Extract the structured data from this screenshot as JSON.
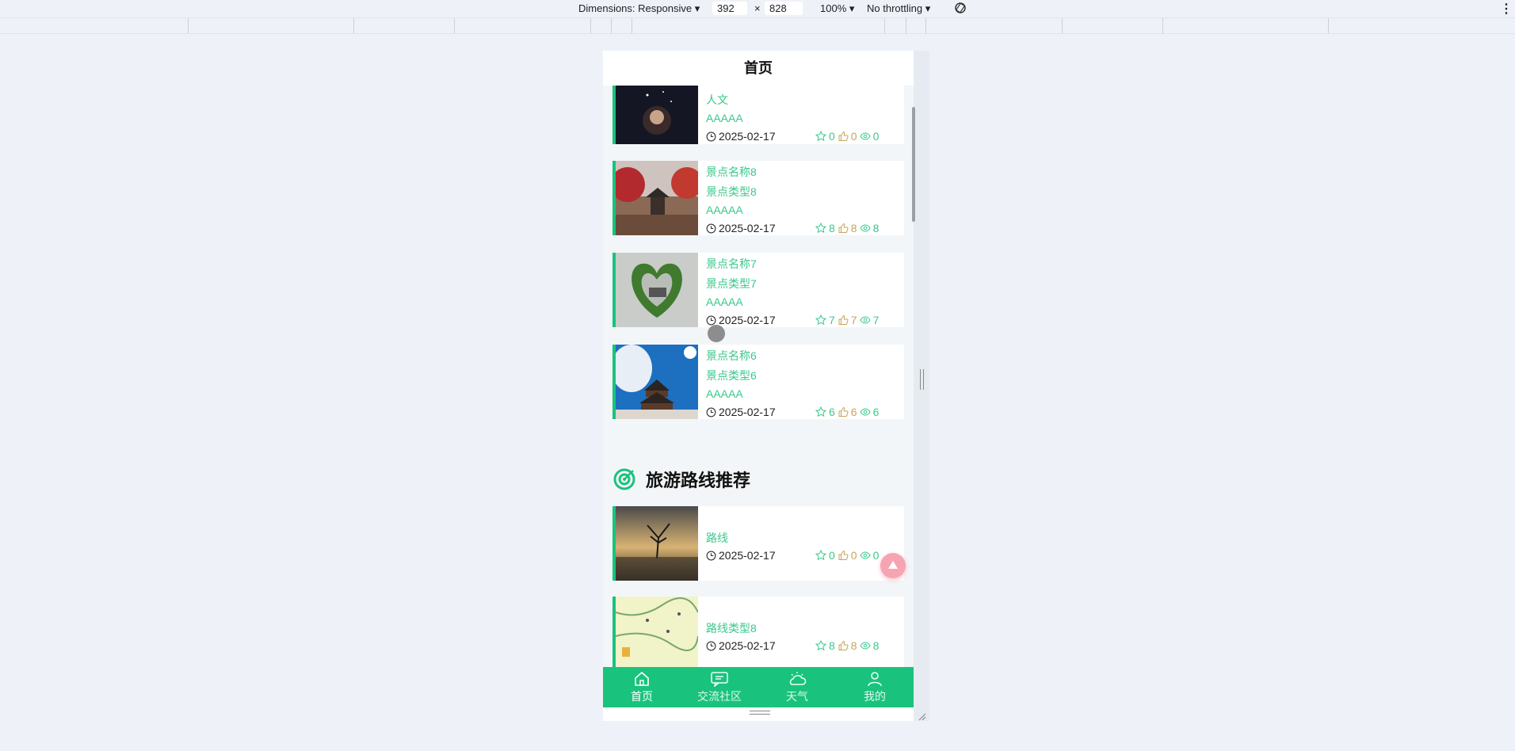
{
  "devtools": {
    "dimensions_label": "Dimensions: Responsive",
    "width": "392",
    "x": "×",
    "height": "828",
    "zoom": "100%",
    "throttling": "No throttling",
    "rotate_icon": "rotate-icon",
    "menu_icon": "more-vertical-icon"
  },
  "header": {
    "title": "首页"
  },
  "scenic_cards": [
    {
      "name": "",
      "type": "人文",
      "level": "AAAAA",
      "date": "2025-02-17",
      "stars": "0",
      "likes": "0",
      "views": "0"
    },
    {
      "name": "景点名称8",
      "type": "景点类型8",
      "level": "AAAAA",
      "date": "2025-02-17",
      "stars": "8",
      "likes": "8",
      "views": "8"
    },
    {
      "name": "景点名称7",
      "type": "景点类型7",
      "level": "AAAAA",
      "date": "2025-02-17",
      "stars": "7",
      "likes": "7",
      "views": "7"
    },
    {
      "name": "景点名称6",
      "type": "景点类型6",
      "level": "AAAAA",
      "date": "2025-02-17",
      "stars": "6",
      "likes": "6",
      "views": "6"
    }
  ],
  "routes_section": {
    "title": "旅游路线推荐"
  },
  "route_cards": [
    {
      "name": "路线",
      "date": "2025-02-17",
      "stars": "0",
      "likes": "0",
      "views": "0"
    },
    {
      "name": "路线类型8",
      "date": "2025-02-17",
      "stars": "8",
      "likes": "8",
      "views": "8"
    }
  ],
  "tabbar": [
    {
      "label": "首页",
      "icon": "home-icon"
    },
    {
      "label": "交流社区",
      "icon": "chat-icon"
    },
    {
      "label": "天气",
      "icon": "weather-icon"
    },
    {
      "label": "我的",
      "icon": "user-icon"
    }
  ],
  "colors": {
    "accent": "#19c37d",
    "text_accent": "#3ac88b",
    "like": "#c7a45a"
  }
}
